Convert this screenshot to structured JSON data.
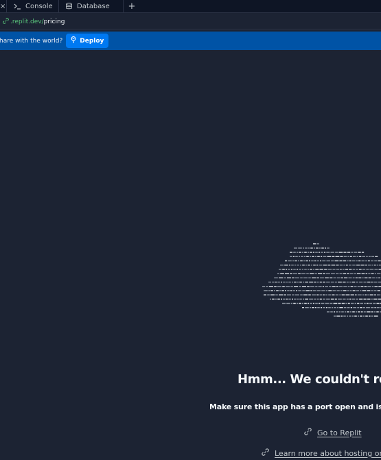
{
  "tabs": {
    "first_close": "×",
    "console_label": "Console",
    "database_label": "Database",
    "add_label": "+",
    "console_icon": "terminal-icon",
    "database_icon": "database-icon"
  },
  "urlbar": {
    "domain": ".replit.dev/",
    "path": "pricing",
    "icon": "link-icon"
  },
  "banner": {
    "text": "hare with the world?",
    "deploy_label": "Deploy",
    "deploy_icon": "deploy-icon"
  },
  "preview": {
    "headline": "Hmm... We couldn't reach",
    "subline": "Make sure this app has a port open and is ready to",
    "link_replit": "Go to Replit",
    "link_learn": "Learn more about hosting on"
  },
  "colors": {
    "background": "#1c2333",
    "tabbar": "#0e1525",
    "banner": "#0053a6",
    "deploy_button": "#0079f2",
    "url_domain": "#58c37a"
  }
}
